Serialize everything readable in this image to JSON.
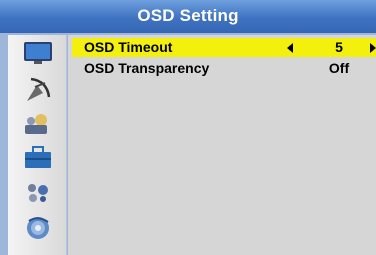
{
  "header": {
    "title": "OSD Setting"
  },
  "sidebar": {
    "icons": [
      {
        "name": "picture-icon"
      },
      {
        "name": "channel-search-icon"
      },
      {
        "name": "system-icon"
      },
      {
        "name": "tools-icon"
      },
      {
        "name": "media-icon"
      },
      {
        "name": "disc-icon"
      }
    ]
  },
  "settings": {
    "items": [
      {
        "label": "OSD Timeout",
        "value": "5",
        "selected": true
      },
      {
        "label": "OSD Transparency",
        "value": "Off",
        "selected": false
      }
    ]
  },
  "colors": {
    "title_bar": "#3f73c2",
    "highlight": "#f2f00c",
    "panel": "#d6d6d6"
  }
}
